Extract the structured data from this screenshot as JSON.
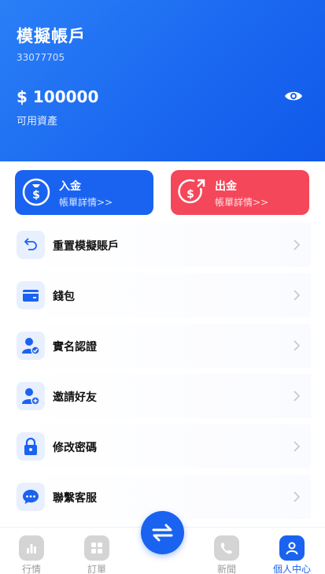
{
  "account": {
    "title": "模擬帳戶",
    "id": "33077705",
    "balance": "$ 100000",
    "balance_label": "可用資產"
  },
  "actions": {
    "deposit": {
      "title": "入金",
      "subtitle": "帳單詳情>>"
    },
    "withdraw": {
      "title": "出金",
      "subtitle": "帳單詳情>>"
    }
  },
  "menu": [
    {
      "label": "重置模擬賬戶",
      "icon": "reset-icon"
    },
    {
      "label": "錢包",
      "icon": "wallet-icon"
    },
    {
      "label": "實名認證",
      "icon": "verified-user-icon"
    },
    {
      "label": "邀請好友",
      "icon": "add-user-icon"
    },
    {
      "label": "修改密碼",
      "icon": "lock-icon"
    },
    {
      "label": "聯繫客服",
      "icon": "chat-icon"
    }
  ],
  "tabs": [
    {
      "label": "行情",
      "icon": "chart-icon"
    },
    {
      "label": "訂單",
      "icon": "grid-icon"
    },
    {
      "label": "新聞",
      "icon": "news-icon"
    },
    {
      "label": "個人中心",
      "icon": "person-icon",
      "active": true
    }
  ],
  "colors": {
    "primary": "#1a63f0",
    "danger": "#f4475a",
    "inactive": "#9a9a9a"
  }
}
